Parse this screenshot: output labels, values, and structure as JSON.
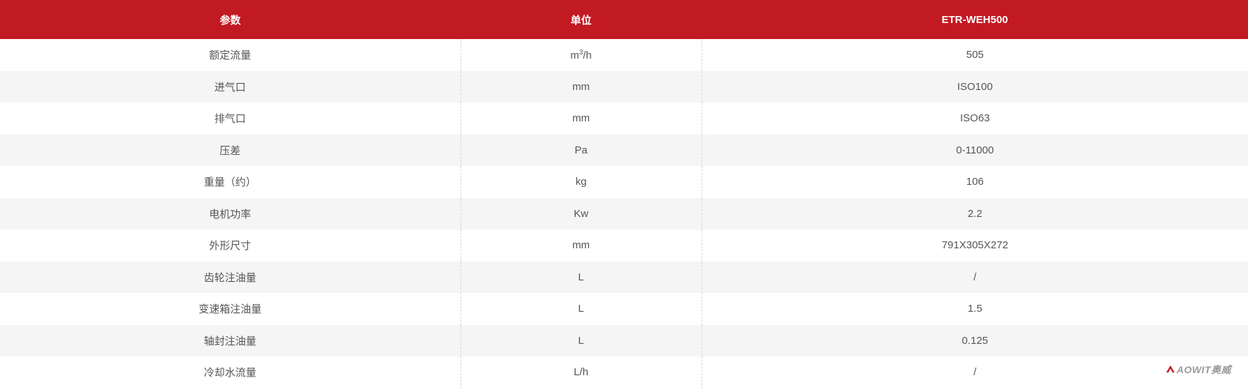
{
  "header": {
    "param": "参数",
    "unit": "单位",
    "model": "ETR-WEH500"
  },
  "rows": [
    {
      "param": "额定流量",
      "unit_base": "m",
      "unit_sup": "3",
      "unit_tail": "/h",
      "value": "505"
    },
    {
      "param": "进气口",
      "unit": "mm",
      "value": "ISO100"
    },
    {
      "param": "排气口",
      "unit": "mm",
      "value": "ISO63"
    },
    {
      "param": "压差",
      "unit": "Pa",
      "value": "0-11000"
    },
    {
      "param": "重量（约）",
      "unit": "kg",
      "value": "106"
    },
    {
      "param": "电机功率",
      "unit": "Kw",
      "value": "2.2"
    },
    {
      "param": "外形尺寸",
      "unit": "mm",
      "value": "791X305X272"
    },
    {
      "param": "齿轮注油量",
      "unit": "L",
      "value": "/"
    },
    {
      "param": "变速箱注油量",
      "unit": "L",
      "value": "1.5"
    },
    {
      "param": "轴封注油量",
      "unit": "L",
      "value": "0.125"
    },
    {
      "param": "冷却水流量",
      "unit": "L/h",
      "value": "/"
    }
  ],
  "watermark": {
    "text": "AOWIT奥威",
    "icon": "aowit-logo-icon"
  },
  "colors": {
    "header_bg": "#c21a22",
    "stripe_bg": "#f5f5f5",
    "text": "#555555"
  }
}
